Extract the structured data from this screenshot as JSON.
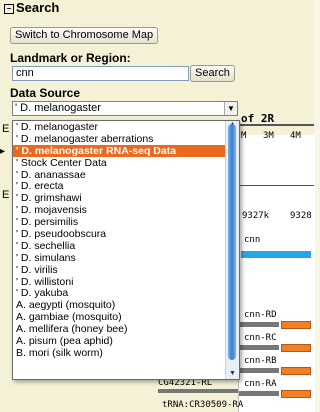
{
  "section_title": "Search",
  "switch_button": "Switch to Chromosome Map",
  "landmark_label": "Landmark or Region:",
  "landmark_value": "cnn",
  "search_button": "Search",
  "datasource_label": "Data Source",
  "datasource_selected": "' D. melanogaster",
  "options": [
    "' D. melanogaster",
    "' D. melanogaster aberrations",
    "' D. melanogaster RNA-seq Data",
    "' Stock Center Data",
    "' D. ananassae",
    "' D. erecta",
    "' D. grimshawi",
    "' D. mojavensis",
    "' D. persimilis",
    "' D. pseudoobscura",
    "' D. sechellia",
    "' D. simulans",
    "' D. virilis",
    "' D. willistoni",
    "' D. yakuba",
    "A. aegypti (mosquito)",
    "A. gambiae (mosquito)",
    "A. mellifera (honey bee)",
    "A. pisum (pea aphid)",
    "B. mori (silk worm)"
  ],
  "selected_index": 2,
  "track": {
    "chrom_label": "of 2R",
    "ticks_top": [
      "M",
      "3M",
      "4M"
    ],
    "ticks_bottom": [
      "9327k",
      "9328"
    ],
    "gene_label": "cnn",
    "transcripts": [
      "cnn-RD",
      "cnn-RC",
      "cnn-RB",
      "cnn-RA"
    ],
    "left_gene": "CG42321-RL",
    "trna": "tRNA:CR30509-RA"
  },
  "colors": {
    "accent": "#ec6a1d",
    "panel": "#f4f1d7",
    "gene_blue": "#23a7e6"
  }
}
